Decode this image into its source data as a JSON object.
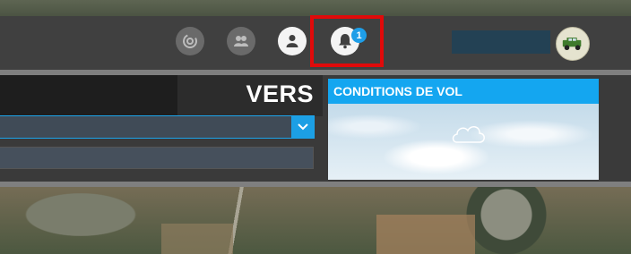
{
  "topbar": {
    "icons": [
      "activity-icon",
      "friends-icon",
      "profile-icon",
      "notifications-icon"
    ],
    "notification_count": "1",
    "highlight_color": "#e00a0a"
  },
  "panel": {
    "title": "VERS"
  },
  "conditions": {
    "header": "CONDITIONS DE VOL"
  },
  "colors": {
    "accent": "#14a6f0",
    "bar": "#404040",
    "panel": "#3a3a3a"
  }
}
